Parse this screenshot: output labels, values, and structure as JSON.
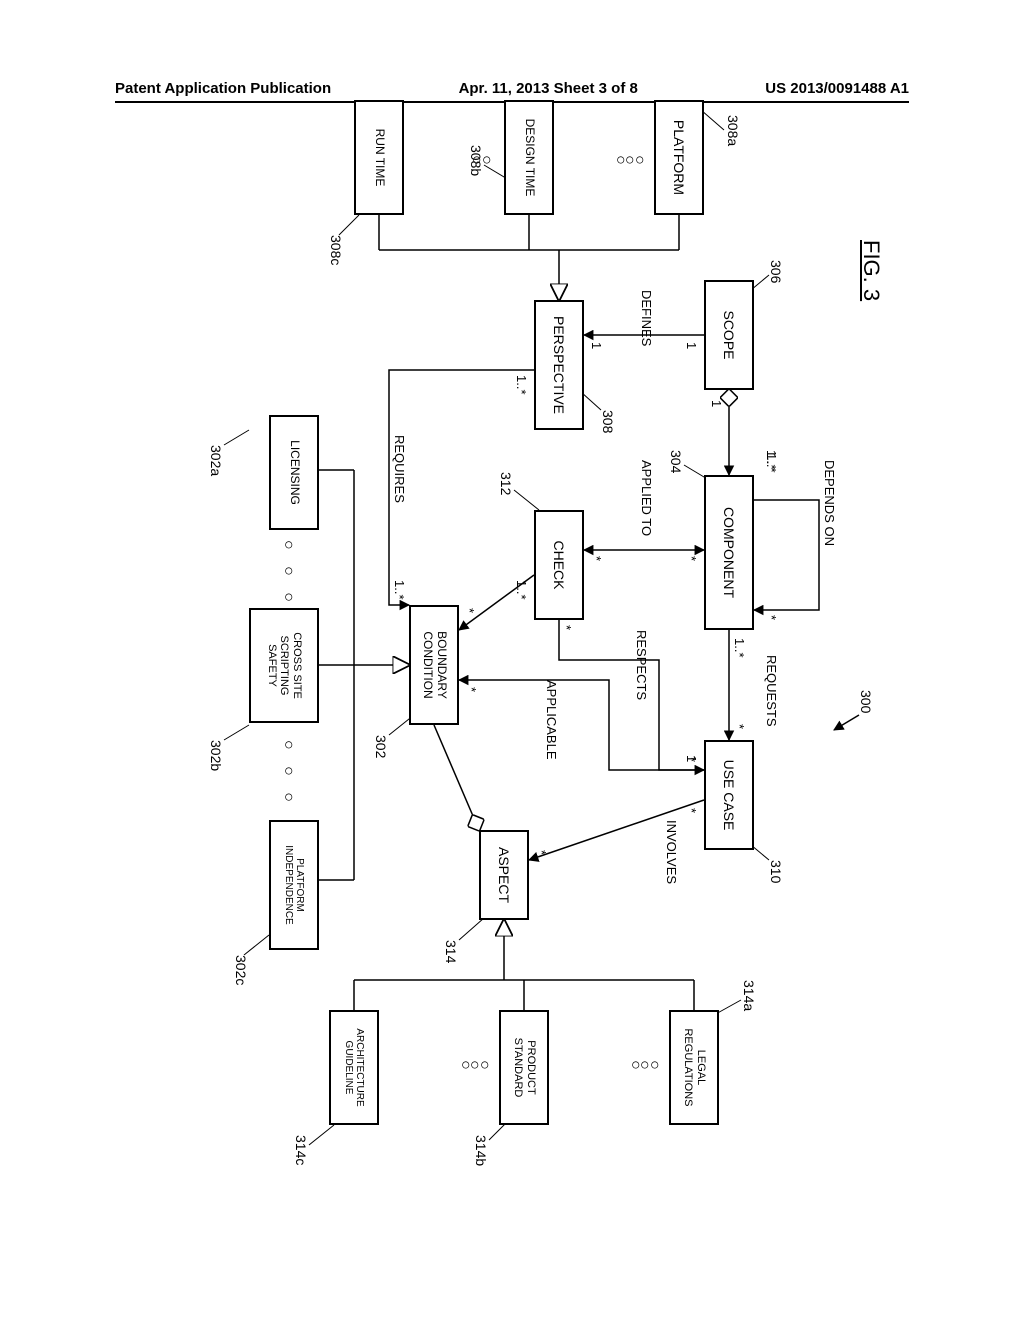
{
  "header": {
    "left": "Patent Application Publication",
    "center": "Apr. 11, 2013  Sheet 3 of 8",
    "right": "US 2013/0091488 A1"
  },
  "figure": {
    "title": "FIG. 3",
    "ref_main": "300"
  },
  "boxes": {
    "scope": "SCOPE",
    "component": "COMPONENT",
    "use_case": "USE CASE",
    "perspective": "PERSPECTIVE",
    "check": "CHECK",
    "boundary_condition": "BOUNDARY CONDITION",
    "aspect": "ASPECT",
    "platform": "PLATFORM",
    "design_time": "DESIGN TIME",
    "run_time": "RUN TIME",
    "licensing": "LICENSING",
    "cross_site": "CROSS SITE SCRIPTING SAFETY",
    "platform_independence": "PLATFORM INDEPENDENCE",
    "legal_regulations": "LEGAL REGULATIONS",
    "product_standard": "PRODUCT STANDARD",
    "architecture_guideline": "ARCHITECTURE GUIDELINE"
  },
  "refs": {
    "scope": "306",
    "component": "304",
    "use_case": "310",
    "perspective": "308",
    "check": "312",
    "boundary_condition": "302",
    "aspect": "314",
    "platform": "308a",
    "design_time": "308b",
    "run_time": "308c",
    "licensing": "302a",
    "cross_site": "302b",
    "platform_independence": "302c",
    "legal_regulations": "314a",
    "product_standard": "314b",
    "architecture_guideline": "314c"
  },
  "relations": {
    "depends_on": "DEPENDS ON",
    "requests": "REQUESTS",
    "defines": "DEFINES",
    "applied_to": "APPLIED TO",
    "respects": "RESPECTS",
    "involves": "INVOLVES",
    "applicable": "APPLICABLE",
    "requires": "REQUIRES"
  },
  "mult": {
    "one": "1",
    "one_plus": "1..*",
    "star": "*"
  }
}
